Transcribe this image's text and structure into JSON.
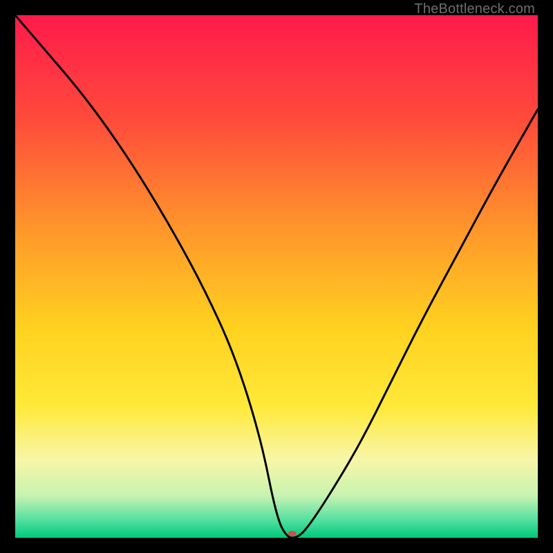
{
  "watermark": "TheBottleneck.com",
  "chart_data": {
    "type": "line",
    "title": "",
    "xlabel": "",
    "ylabel": "",
    "xlim": [
      0,
      100
    ],
    "ylim": [
      0,
      100
    ],
    "grid": false,
    "legend": false,
    "background_gradient_stops": [
      {
        "offset": 0.0,
        "color": "#ff1a4b"
      },
      {
        "offset": 0.2,
        "color": "#ff4b3b"
      },
      {
        "offset": 0.42,
        "color": "#ff9a2a"
      },
      {
        "offset": 0.6,
        "color": "#ffd21f"
      },
      {
        "offset": 0.75,
        "color": "#ffe93a"
      },
      {
        "offset": 0.85,
        "color": "#f8f6a8"
      },
      {
        "offset": 0.92,
        "color": "#c7f3b0"
      },
      {
        "offset": 0.965,
        "color": "#55e0a0"
      },
      {
        "offset": 1.0,
        "color": "#00c97b"
      }
    ],
    "series": [
      {
        "name": "bottleneck-curve",
        "x": [
          0,
          6,
          12,
          18,
          24,
          30,
          36,
          42,
          47,
          50,
          52,
          54,
          56,
          60,
          66,
          72,
          78,
          85,
          92,
          100
        ],
        "y": [
          100,
          93,
          86,
          78,
          69,
          59,
          48,
          35,
          19,
          4,
          0,
          0,
          2,
          8,
          18,
          30,
          42,
          55,
          68,
          82
        ]
      }
    ],
    "marker": {
      "x": 53,
      "y": 0.8,
      "color": "#d24a4a",
      "rx": 6,
      "ry": 4
    }
  }
}
